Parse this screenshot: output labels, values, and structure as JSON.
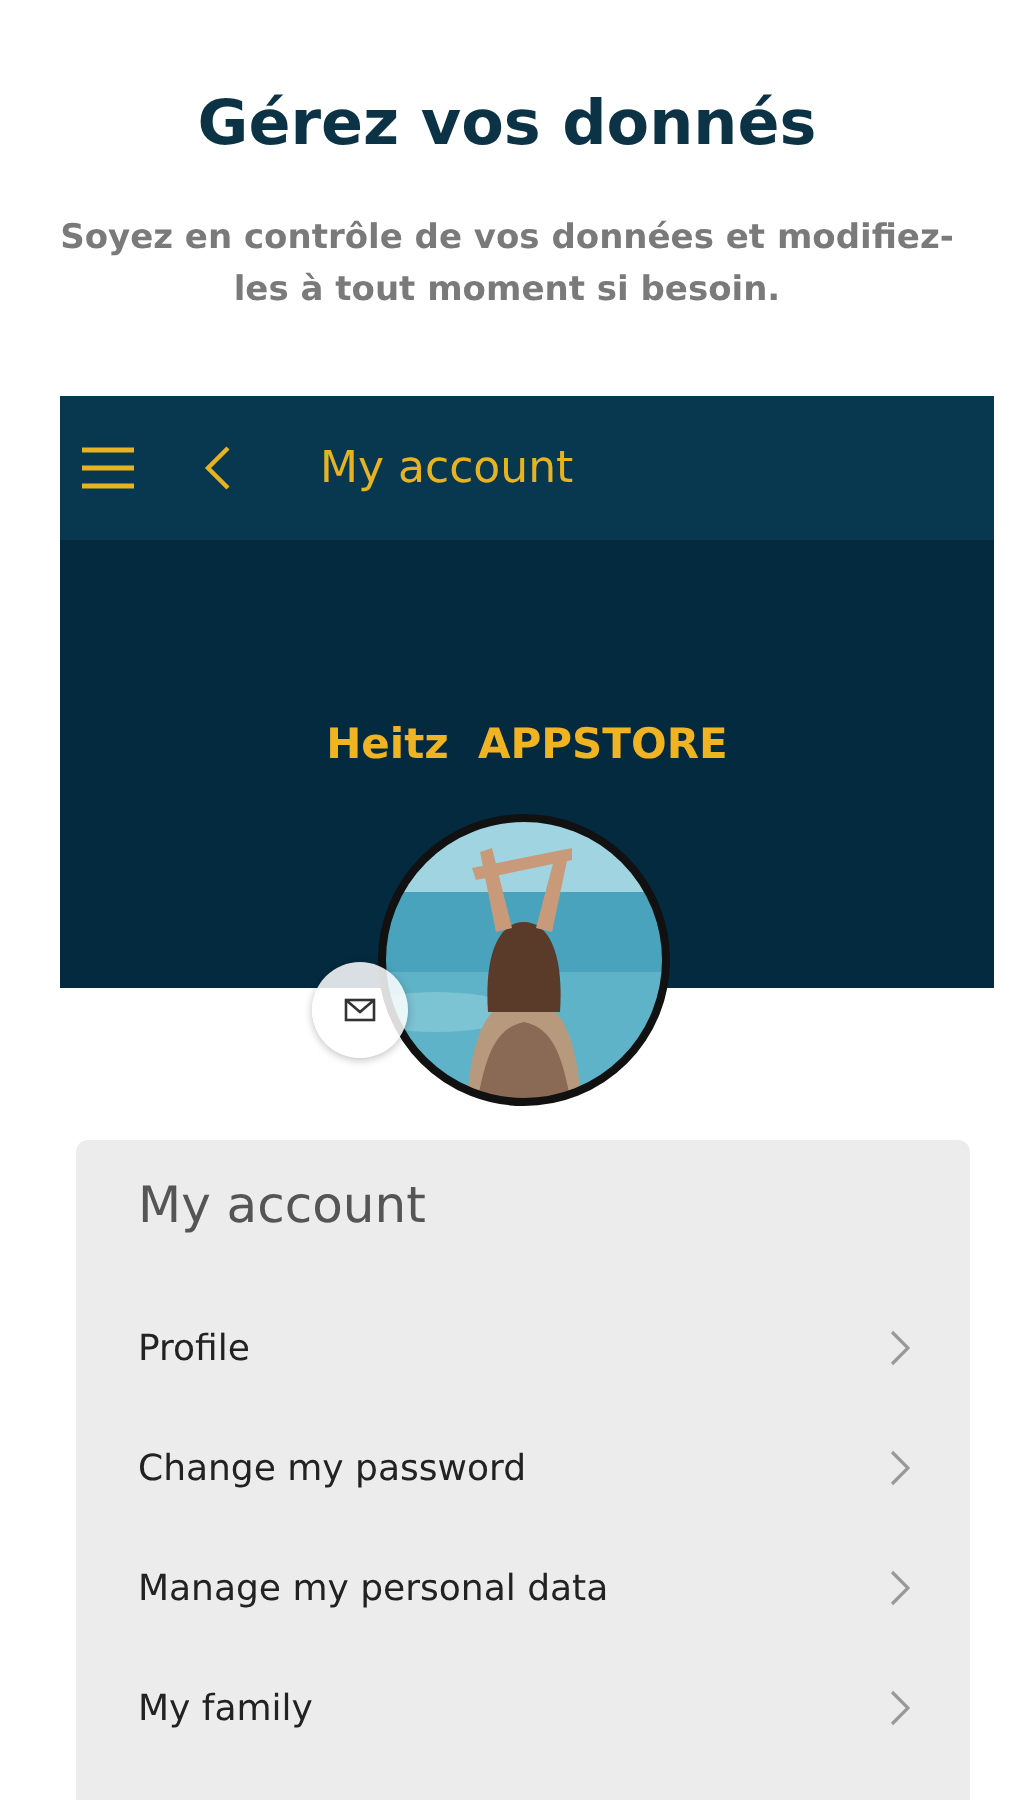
{
  "heading": "Gérez vos donnés",
  "subtitle": "Soyez en contrôle de vos données et modifiez-les à tout moment si besoin.",
  "app_bar": {
    "title": "My account"
  },
  "profile": {
    "name": "Heitz  APPSTORE"
  },
  "card": {
    "title": "My account",
    "items": [
      {
        "label": "Profile"
      },
      {
        "label": "Change my password"
      },
      {
        "label": "Manage my personal data"
      },
      {
        "label": "My family"
      }
    ]
  }
}
